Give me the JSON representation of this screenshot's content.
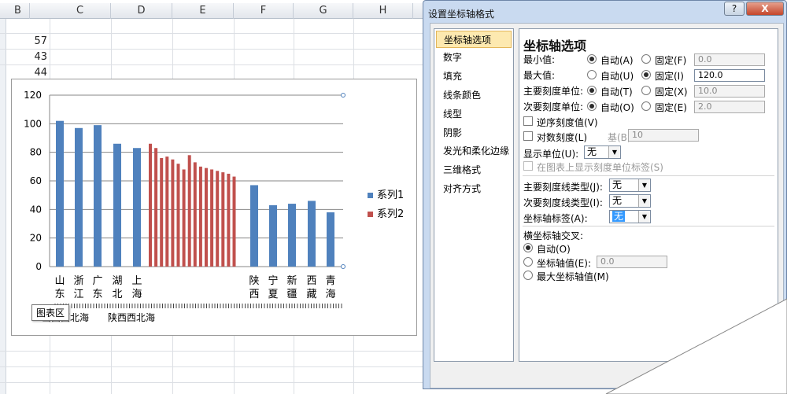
{
  "sheet": {
    "columns": [
      "B",
      "C",
      "D",
      "E",
      "F",
      "G",
      "H"
    ],
    "cell_values": [
      "57",
      "43",
      "44"
    ],
    "tooltip": "图表区"
  },
  "chart_data": {
    "type": "bar",
    "ylim": [
      0,
      120
    ],
    "yticks": [
      0,
      20,
      40,
      60,
      80,
      100,
      120
    ],
    "series": [
      {
        "name": "系列1",
        "color": "#4f81bd",
        "points": [
          {
            "slot": 0,
            "value": 102
          },
          {
            "slot": 1,
            "value": 97
          },
          {
            "slot": 2,
            "value": 99
          },
          {
            "slot": 3,
            "value": 86
          },
          {
            "slot": 4,
            "value": 83
          },
          {
            "slot": 5,
            "value": 57
          },
          {
            "slot": 6,
            "value": 43
          },
          {
            "slot": 7,
            "value": 44
          },
          {
            "slot": 8,
            "value": 46
          },
          {
            "slot": 9,
            "value": 38
          }
        ]
      },
      {
        "name": "系列2",
        "color": "#c0504d",
        "values": [
          86,
          83,
          76,
          77,
          75,
          72,
          68,
          78,
          73,
          70,
          69,
          68,
          67,
          66,
          65,
          63
        ]
      }
    ],
    "categories_left": [
      "山东",
      "浙江",
      "广东",
      "湖北",
      "上海"
    ],
    "categories_right": [
      "陕西",
      "宁夏",
      "新疆",
      "西藏",
      "青海"
    ],
    "overlap_labels": [
      "山西西北海",
      "陕西西北海"
    ],
    "legend_position": "right",
    "grid": true
  },
  "dialog": {
    "title": "设置坐标轴格式",
    "help": "?",
    "close": "X",
    "nav": [
      "坐标轴选项",
      "数字",
      "填充",
      "线条颜色",
      "线型",
      "阴影",
      "发光和柔化边缘",
      "三维格式",
      "对齐方式"
    ],
    "panel_title": "坐标轴选项",
    "rows": [
      {
        "label": "最小值:",
        "auto": "自动(A)",
        "fixed": "固定(F)",
        "value": "0.0",
        "auto_on": true
      },
      {
        "label": "最大值:",
        "auto": "自动(U)",
        "fixed": "固定(I)",
        "value": "120.0",
        "auto_on": false
      },
      {
        "label": "主要刻度单位:",
        "auto": "自动(T)",
        "fixed": "固定(X)",
        "value": "10.0",
        "auto_on": true
      },
      {
        "label": "次要刻度单位:",
        "auto": "自动(O)",
        "fixed": "固定(E)",
        "value": "2.0",
        "auto_on": true
      }
    ],
    "reverse": "逆序刻度值(V)",
    "log_scale": "对数刻度(L)",
    "base_label": "基(B):",
    "base_value": "10",
    "display_unit_label": "显示单位(U):",
    "display_unit_value": "无",
    "show_unit_label": "在图表上显示刻度单位标签(S)",
    "major_tick_label": "主要刻度线类型(J):",
    "major_tick_value": "无",
    "minor_tick_label": "次要刻度线类型(I):",
    "minor_tick_value": "无",
    "axis_label_label": "坐标轴标签(A):",
    "axis_label_value": "无",
    "cross_title": "横坐标轴交叉:",
    "cross_auto": "自动(O)",
    "cross_value_label": "坐标轴值(E):",
    "cross_value": "0.0",
    "cross_max": "最大坐标轴值(M)"
  }
}
